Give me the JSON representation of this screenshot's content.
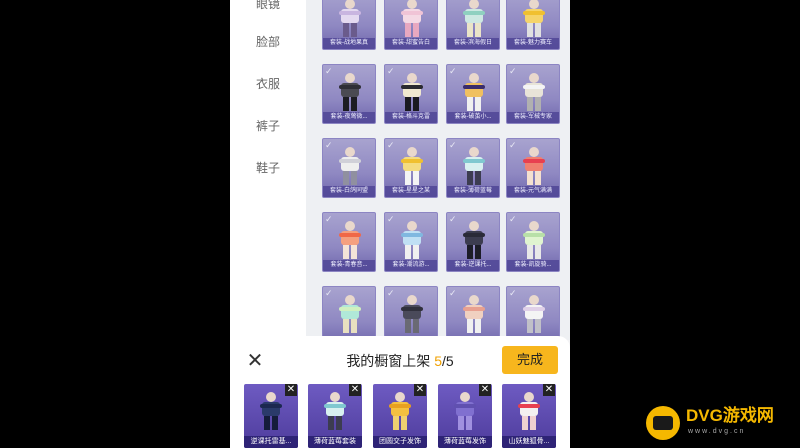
{
  "categories": [
    "眼镜",
    "脸部",
    "衣服",
    "裤子",
    "鞋子"
  ],
  "grid": {
    "check_glyph": "✓",
    "items": [
      {
        "caption": "套装-战地果真",
        "colors": [
          "#e4d9f0",
          "#c9b5e0",
          "#6a5b8c"
        ]
      },
      {
        "caption": "套装-甜蜜告白",
        "colors": [
          "#f4d9e4",
          "#f0c4d6",
          "#e8a8c0"
        ]
      },
      {
        "caption": "套装-滨海假日",
        "colors": [
          "#cde8e2",
          "#8fd0c0",
          "#eae4c8"
        ]
      },
      {
        "caption": "套装-魅力赛车",
        "colors": [
          "#f5d46a",
          "#f0c030",
          "#e0e0e0"
        ]
      },
      {
        "caption": "套装-夜莺微...",
        "colors": [
          "#4a4a52",
          "#2e2e36",
          "#1c1c22"
        ]
      },
      {
        "caption": "套装-格斗克雷",
        "colors": [
          "#f0e8d0",
          "#2a2a30",
          "#1a1a20"
        ]
      },
      {
        "caption": "套装-破茧小...",
        "colors": [
          "#f0c060",
          "#3a2c6c",
          "#f0f0f0"
        ]
      },
      {
        "caption": "套装-军械专家",
        "colors": [
          "#e8e4d8",
          "#f4f4f4",
          "#b0b0b0"
        ]
      },
      {
        "caption": "套装-白鸽同盟",
        "colors": [
          "#eeeeee",
          "#d0d0d8",
          "#9090a0"
        ]
      },
      {
        "caption": "套装-星星之某",
        "colors": [
          "#f4dc80",
          "#f0c030",
          "#f4f4f4"
        ]
      },
      {
        "caption": "套装-薄荷蓝莓",
        "colors": [
          "#d8f0f0",
          "#80c8d0",
          "#3c3c50"
        ]
      },
      {
        "caption": "套装-元气满满",
        "colors": [
          "#f08070",
          "#e84050",
          "#f4e0d0"
        ]
      },
      {
        "caption": "套装-青春音...",
        "colors": [
          "#f4a080",
          "#f06848",
          "#f4e4d8"
        ]
      },
      {
        "caption": "套装-潮流游...",
        "colors": [
          "#c0e0f4",
          "#80b8e0",
          "#f0f0f0"
        ]
      },
      {
        "caption": "套装-逆课托...",
        "colors": [
          "#3c3c50",
          "#2a2a38",
          "#1c1c28"
        ]
      },
      {
        "caption": "套装-凯旋骑...",
        "colors": [
          "#e0f4d0",
          "#b8e0a8",
          "#e8e8e8"
        ]
      },
      {
        "caption": "",
        "colors": [
          "#b0e8d8",
          "#d0f0c0",
          "#e8e0c0"
        ]
      },
      {
        "caption": "",
        "colors": [
          "#4a4a5a",
          "#30303c",
          "#6a6a74"
        ]
      },
      {
        "caption": "",
        "colors": [
          "#f0d0c0",
          "#e8a090",
          "#f0f0f0"
        ]
      },
      {
        "caption": "",
        "colors": [
          "#f4f4f4",
          "#e0d0e8",
          "#c0c0c8"
        ]
      }
    ]
  },
  "sheet": {
    "close_glyph": "✕",
    "title_prefix": "我的橱窗上架 ",
    "count_current": "5",
    "count_sep_total": "/5",
    "done_label": "完成",
    "remove_glyph": "✕",
    "slots": [
      {
        "caption": "逆课托雷基...",
        "colors": [
          "#2a3a6a",
          "#1c2850",
          "#141c3a"
        ]
      },
      {
        "caption": "薄荷蓝莓套装",
        "colors": [
          "#d8f0f0",
          "#80c8d0",
          "#3c3c50"
        ]
      },
      {
        "caption": "团圆交子发饰",
        "colors": [
          "#f4c040",
          "#e8a020",
          "#f0d070"
        ]
      },
      {
        "caption": "薄荷蓝莓发饰",
        "colors": [
          "#8070d0",
          "#6050b0",
          "#a090e0"
        ]
      },
      {
        "caption": "山妖魅狐骨...",
        "colors": [
          "#f4f0f0",
          "#e84050",
          "#f0d0d0"
        ]
      }
    ]
  },
  "watermark": {
    "text": "DVG游戏网",
    "sub": "www.dvg.cn",
    "color": "#f5b800"
  }
}
